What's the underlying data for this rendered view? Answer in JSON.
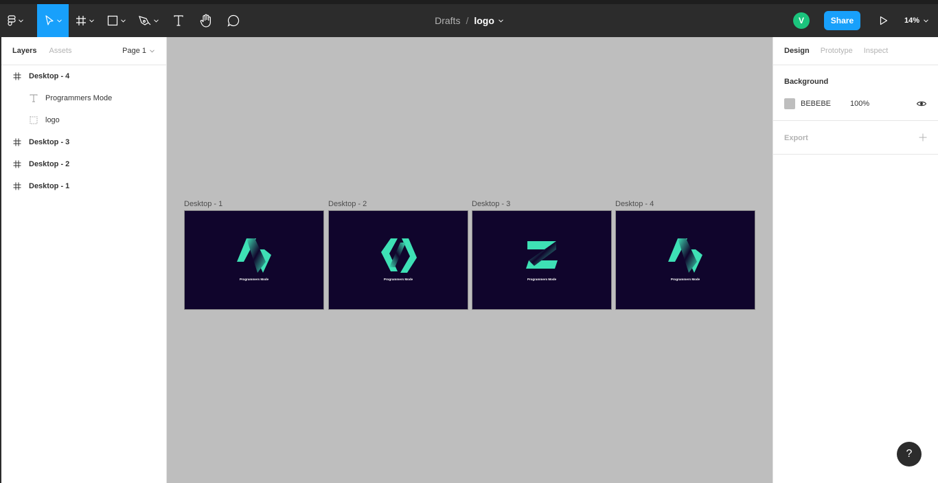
{
  "toolbar": {
    "breadcrumb_drafts": "Drafts",
    "breadcrumb_sep": "/",
    "file_name": "logo",
    "avatar_initial": "V",
    "share_label": "Share",
    "zoom_label": "14%"
  },
  "left_panel": {
    "tab_layers": "Layers",
    "tab_assets": "Assets",
    "page_label": "Page 1",
    "layers": [
      {
        "label": "Desktop - 4"
      },
      {
        "label": "Programmers Mode"
      },
      {
        "label": "logo"
      },
      {
        "label": "Desktop - 3"
      },
      {
        "label": "Desktop - 2"
      },
      {
        "label": "Desktop - 1"
      }
    ]
  },
  "canvas": {
    "background": "#BEBEBE",
    "frames": [
      {
        "label": "Desktop - 1",
        "text": "Programmers Mode"
      },
      {
        "label": "Desktop - 2",
        "text": "Programmers Mode"
      },
      {
        "label": "Desktop - 3",
        "text": "Programmers Mode"
      },
      {
        "label": "Desktop - 4",
        "text": "Programmers Mode"
      }
    ]
  },
  "right_panel": {
    "tab_design": "Design",
    "tab_prototype": "Prototype",
    "tab_inspect": "Inspect",
    "background_title": "Background",
    "background_hex": "BEBEBE",
    "background_opacity": "100%",
    "export_title": "Export"
  },
  "help_label": "?",
  "colors": {
    "accent": "#18a0fb",
    "avatar": "#1bc47d",
    "frame_bg": "#10052c",
    "logo": "#3ee0b5"
  }
}
